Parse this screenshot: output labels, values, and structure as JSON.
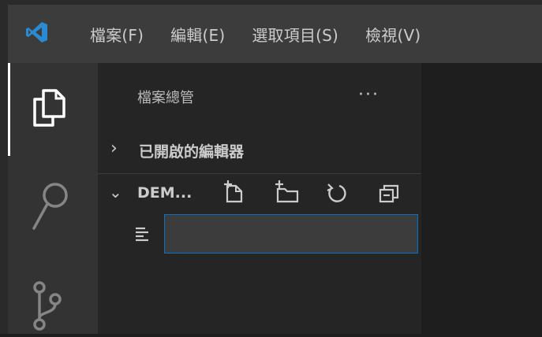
{
  "menubar": {
    "items": [
      "檔案(F)",
      "編輯(E)",
      "選取項目(S)",
      "檢視(V)"
    ]
  },
  "activity_bar": {
    "icons": [
      "explorer-icon",
      "search-icon",
      "source-control-icon"
    ],
    "active": "explorer-icon"
  },
  "sidebar": {
    "title": "檔案總管",
    "more_label": "···",
    "sections": {
      "open_editors": {
        "chevron": "›",
        "label": "已開啟的編輯器"
      },
      "workspace": {
        "chevron": "⌄",
        "label": "DEM..."
      }
    },
    "actions": [
      "new-file-icon",
      "new-folder-icon",
      "refresh-icon",
      "collapse-all-icon"
    ],
    "new_file_input": {
      "value": "",
      "placeholder": ""
    }
  },
  "colors": {
    "accent": "#0e70c0",
    "titlebar": "#3c3c3c",
    "activity_bar": "#333333",
    "sidebar": "#252526",
    "editor": "#1e1e1e",
    "logo_blue": "#2a8ad4"
  }
}
